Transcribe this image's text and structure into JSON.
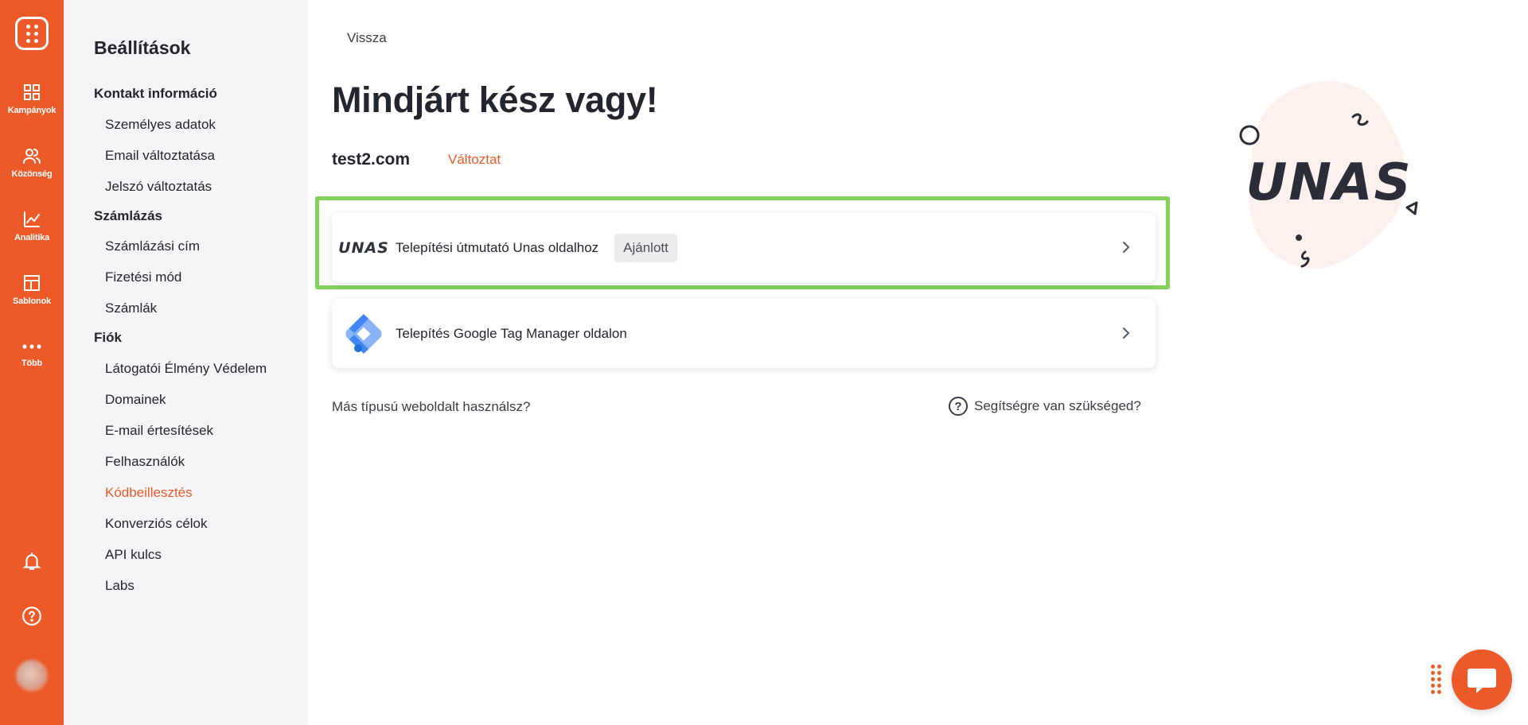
{
  "rail": {
    "items": [
      {
        "label": "Kampányok",
        "icon": "grid-icon"
      },
      {
        "label": "Közönség",
        "icon": "users-icon"
      },
      {
        "label": "Analitika",
        "icon": "chart-icon"
      },
      {
        "label": "Sablonok",
        "icon": "layout-icon"
      },
      {
        "label": "Több",
        "icon": "more-icon"
      }
    ]
  },
  "sidebar": {
    "title": "Beállítások",
    "sections": [
      {
        "label": "Kontakt információ",
        "items": [
          "Személyes adatok",
          "Email változtatása",
          "Jelszó változtatás"
        ]
      },
      {
        "label": "Számlázás",
        "items": [
          "Számlázási cím",
          "Fizetési mód",
          "Számlák"
        ]
      },
      {
        "label": "Fiók",
        "items": [
          "Látogatói Élmény Védelem",
          "Domainek",
          "E-mail értesítések",
          "Felhasználók",
          "Kódbeillesztés",
          "Konverziós célok",
          "API kulcs",
          "Labs"
        ]
      }
    ],
    "active_item": "Kódbeillesztés"
  },
  "main": {
    "back": "Vissza",
    "title": "Mindjárt kész vagy!",
    "domain": "test2.com",
    "change": "Változtat",
    "cards": [
      {
        "logo_text": "UNAS",
        "label": "Telepítési útmutató Unas oldalhoz",
        "badge": "Ajánlott"
      },
      {
        "label": "Telepítés Google Tag Manager oldalon"
      }
    ],
    "other_site": "Más típusú weboldalt használsz?",
    "help": "Segítségre van szükséged?",
    "illustration_text": "UNAS"
  },
  "colors": {
    "brand": "#ed5a29",
    "highlight": "#82d158",
    "sidebar_bg": "#f5f5f7",
    "text": "#23262f"
  }
}
